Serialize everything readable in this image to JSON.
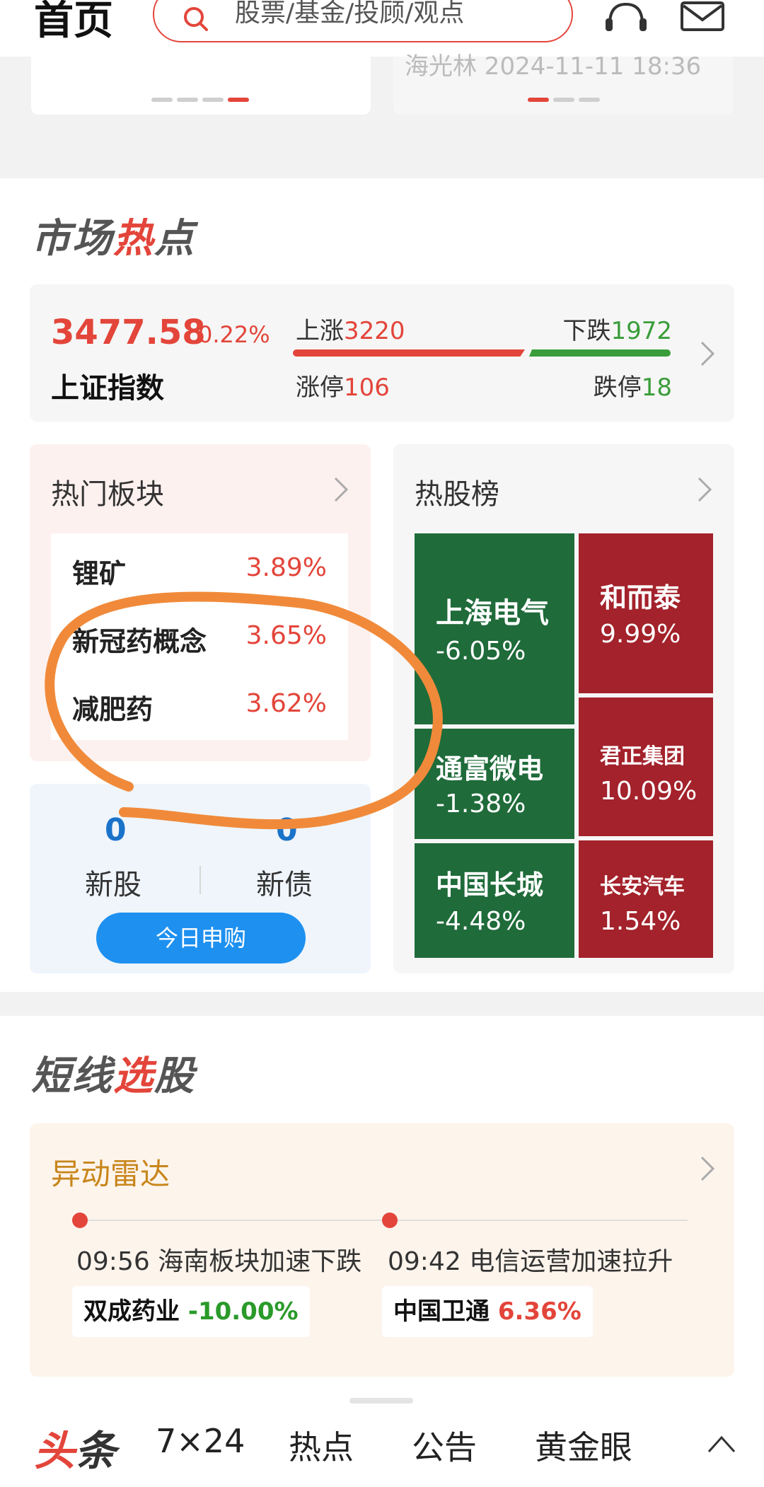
{
  "header": {
    "title": "首页",
    "search_placeholder": "股票/基金/投顾/观点"
  },
  "carousel_snippet": "海光林 2024-11-11 18:36",
  "market_hot": {
    "title_pre": "市场",
    "title_hl": "热",
    "title_post": "点",
    "index": {
      "value": "3477.58",
      "pct": "0.22%",
      "name": "上证指数",
      "up_label": "上涨",
      "up_count": "3220",
      "down_label": "下跌",
      "down_count": "1972",
      "limit_up_label": "涨停",
      "limit_up_count": "106",
      "limit_down_label": "跌停",
      "limit_down_count": "18"
    },
    "hot_sectors": {
      "title": "热门板块",
      "items": [
        {
          "name": "锂矿",
          "pct": "3.89%"
        },
        {
          "name": "新冠药概念",
          "pct": "3.65%"
        },
        {
          "name": "减肥药",
          "pct": "3.62%"
        }
      ]
    },
    "ipo": {
      "new_stock_count": "0",
      "new_stock_label": "新股",
      "new_bond_count": "0",
      "new_bond_label": "新债",
      "button": "今日申购"
    },
    "hot_stocks": {
      "title": "热股榜",
      "items": [
        {
          "name": "上海电气",
          "pct": "-6.05%",
          "color": "#1f6b3a"
        },
        {
          "name": "和而泰",
          "pct": "9.99%",
          "color": "#a3222b"
        },
        {
          "name": "通富微电",
          "pct": "-1.38%",
          "color": "#1f6b3a"
        },
        {
          "name": "君正集团",
          "pct": "10.09%",
          "color": "#a3222b"
        },
        {
          "name": "中国长城",
          "pct": "-4.48%",
          "color": "#1f6b3a"
        },
        {
          "name": "长安汽车",
          "pct": "1.54%",
          "color": "#a3222b"
        }
      ]
    }
  },
  "short_pick": {
    "title_pre": "短线",
    "title_hl": "选",
    "title_post": "股",
    "radar_title": "异动雷达",
    "events": [
      {
        "time_text": "09:56 海南板块加速下跌",
        "stock": "双成药业",
        "pct": "-10.00%"
      },
      {
        "time_text": "09:42 电信运营加速拉升",
        "stock": "中国卫通",
        "pct": "6.36%"
      }
    ]
  },
  "bottom_nav": {
    "logo_hl": "头",
    "logo_rest": "条",
    "tabs": [
      "7×24",
      "热点",
      "公告",
      "黄金眼"
    ]
  },
  "colors": {
    "accent_red": "#e3453a",
    "up_green": "#3a9d3a",
    "ipo_blue": "#1e90f0",
    "radar_gold": "#c8861c",
    "annotation_orange": "#f08a3a"
  }
}
